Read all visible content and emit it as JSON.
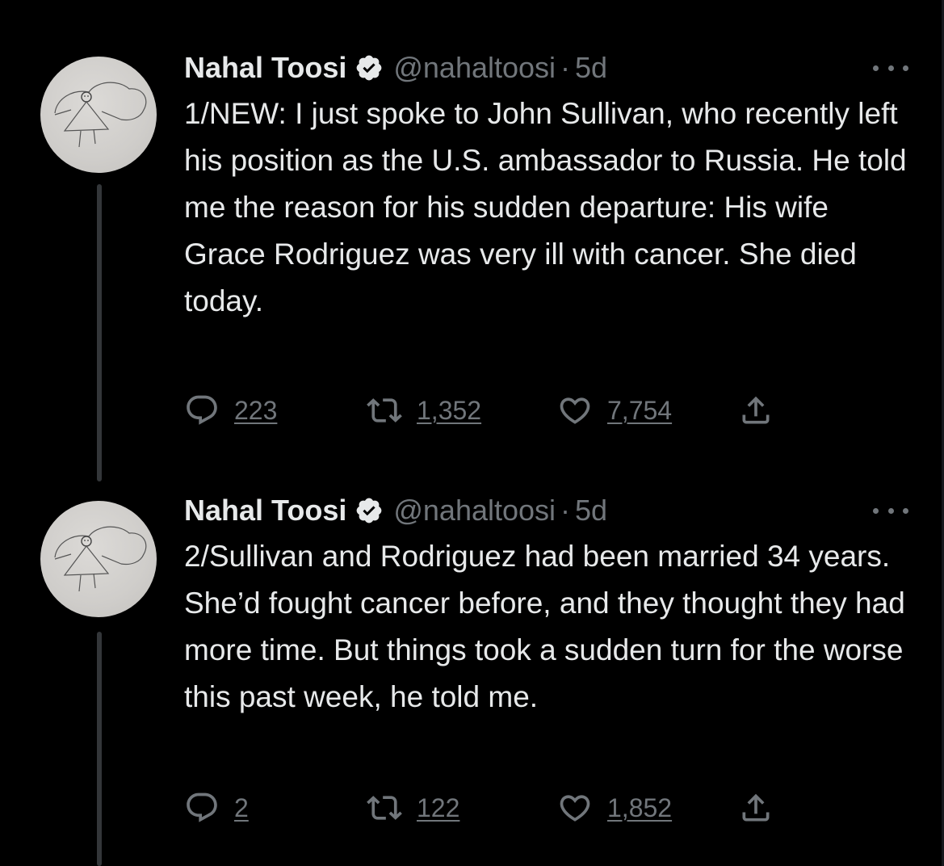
{
  "colors": {
    "background": "#000000",
    "primary_text": "#e7e9ea",
    "secondary_text": "#71767b",
    "thread_line": "#333639",
    "verified_badge": "#e7e9ea"
  },
  "tweets": [
    {
      "display_name": "Nahal Toosi",
      "verified": true,
      "handle": "@nahaltoosi",
      "separator": "·",
      "time": "5d",
      "text": "1/NEW: I just spoke to John Sullivan, who recently left his position as the U.S. ambassador to Russia. He told me the reason for his sudden departure: His wife Grace Rodriguez was very ill with cancer. She died today.",
      "replies": "223",
      "retweets": "1,352",
      "likes": "7,754",
      "icons": [
        "reply-icon",
        "retweet-icon",
        "like-icon",
        "share-icon",
        "more-icon",
        "verified-icon"
      ]
    },
    {
      "display_name": "Nahal Toosi",
      "verified": true,
      "handle": "@nahaltoosi",
      "separator": "·",
      "time": "5d",
      "text": "2/Sullivan and Rodriguez had been married 34 years. She’d fought cancer before, and they thought they had more time. But things took a sudden turn for the worse this past week, he told me.",
      "replies": "2",
      "retweets": "122",
      "likes": "1,852",
      "icons": [
        "reply-icon",
        "retweet-icon",
        "like-icon",
        "share-icon",
        "more-icon",
        "verified-icon"
      ]
    }
  ]
}
